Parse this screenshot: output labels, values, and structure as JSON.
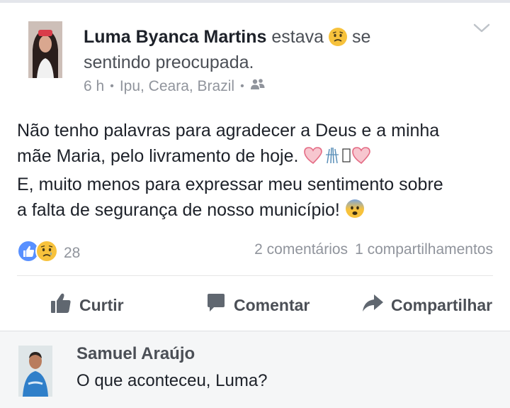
{
  "post": {
    "author": "Luma Byanca Martins",
    "feeling_prefix": "estava",
    "feeling_suffix": "se",
    "feeling_line2": "sentindo preocupada.",
    "time": "6 h",
    "location": "Ipu, Ceara, Brazil",
    "audience_icon": "friends-icon",
    "body_lines": [
      "Não tenho palavras para agradecer a Deus e a minha",
      "mãe Maria, pelo livramento de hoje.",
      "E, muito menos para expressar meu sentimento sobre",
      "a falta de segurança de nosso município!"
    ]
  },
  "reactions": {
    "count": "28",
    "icons": [
      "like-reaction-icon",
      "sad-reaction-icon"
    ]
  },
  "stats": {
    "comments": "2 comentários",
    "shares": "1 compartilhamentos"
  },
  "actions": {
    "like": "Curtir",
    "comment": "Comentar",
    "share": "Compartilhar"
  },
  "comment": {
    "author": "Samuel Araújo",
    "text": "O que aconteceu, Luma?"
  },
  "colors": {
    "like_blue": "#5890ff",
    "sad_yellow": "#f7c23c",
    "text_gray": "#90949c",
    "comment_bg": "#f5f6f7"
  }
}
